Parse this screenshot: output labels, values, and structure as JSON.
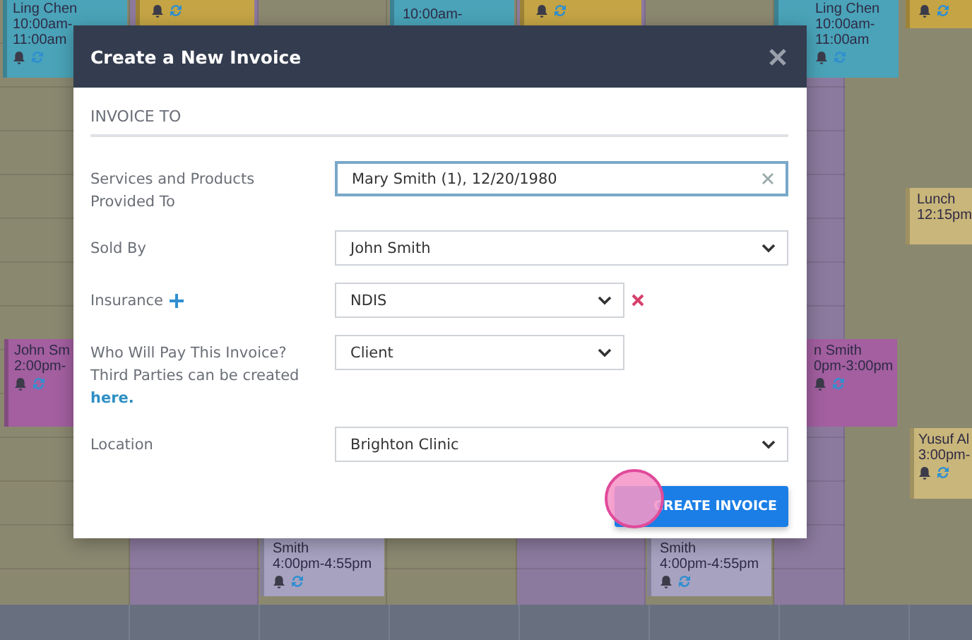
{
  "calendar": {
    "appointments": [
      {
        "color": "#4aa3b8",
        "lines": [
          "Ling Chen",
          "10:00am-",
          "11:00am"
        ],
        "icons": true
      },
      {
        "color": "#c4a445",
        "icons": true
      },
      {
        "color": "#4aa3b8",
        "lines": [
          "10:00am-"
        ],
        "icons": false
      },
      {
        "color": "#c4a445",
        "icons": true
      },
      {
        "color": "#4aa3b8",
        "lines": [
          "Ling Chen",
          "10:00am-",
          "11:00am"
        ],
        "icons": true
      },
      {
        "color": "#c4a445",
        "icons": true
      },
      {
        "color": "#c9b67a",
        "lines": [
          "Lunch",
          "12:15pm"
        ],
        "icons": false
      },
      {
        "color": "#a35fa0",
        "lines": [
          "John Sm",
          "2:00pm-"
        ],
        "icons": true
      },
      {
        "color": "#a35fa0",
        "lines": [
          "n Smith",
          "0pm-3:00pm"
        ],
        "icons": true
      },
      {
        "color": "#c9b67a",
        "lines": [
          "Yusuf Al",
          "3:00pm-"
        ],
        "icons": true
      },
      {
        "color": "#a7a2c0",
        "lines": [
          "Smith",
          "4:00pm-4:55pm"
        ],
        "icons": true
      },
      {
        "color": "#a7a2c0",
        "lines": [
          "Smith",
          "4:00pm-4:55pm"
        ],
        "icons": true
      }
    ]
  },
  "dialog": {
    "title": "Create a New Invoice",
    "section": "INVOICE TO",
    "fields": [
      {
        "kind": "text",
        "label": "Services and Products Provided To",
        "value": "Mary Smith (1), 12/20/1980",
        "focused": true
      },
      {
        "kind": "select",
        "label": "Sold By",
        "value": "John Smith",
        "focused": false
      },
      {
        "kind": "select",
        "label": "Insurance",
        "value": "NDIS",
        "focused": false,
        "addable": true,
        "removable": true
      },
      {
        "kind": "select",
        "label": "Who Will Pay This Invoice?",
        "note": "Third Parties can be created",
        "link": "here.",
        "value": "Client",
        "focused": false
      },
      {
        "kind": "select",
        "label": "Location",
        "value": "Brighton Clinic",
        "focused": false
      }
    ],
    "button": "CREATE INVOICE"
  }
}
